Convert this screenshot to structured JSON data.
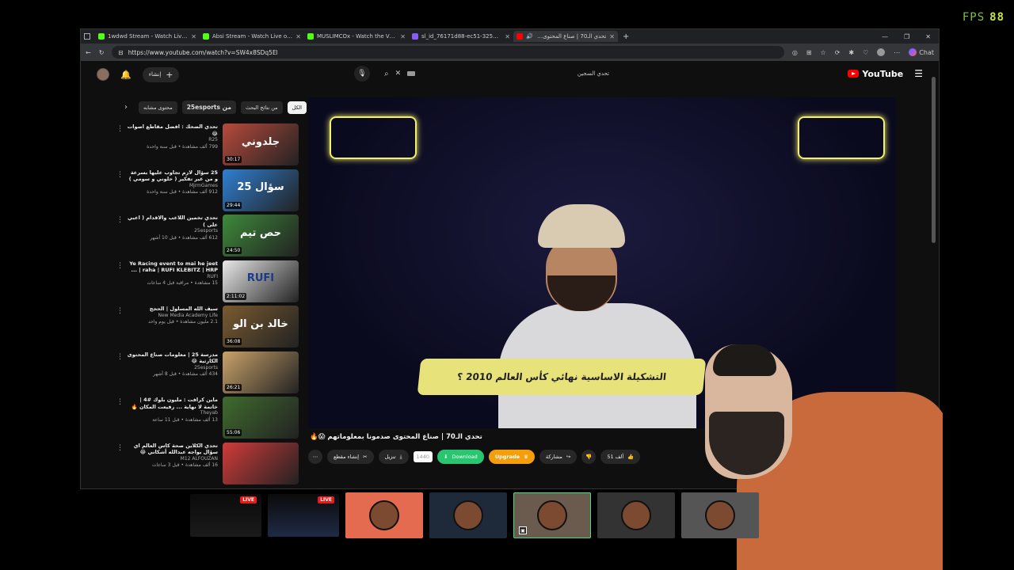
{
  "fps": {
    "label": "FPS",
    "value": "88"
  },
  "tabs": [
    {
      "title": "1wdwd Stream - Watch Live on Ki",
      "fav": "kick"
    },
    {
      "title": "Absi Stream - Watch Live on Kick",
      "fav": "kick"
    },
    {
      "title": "MUSLIMCOx - Watch the VOD or",
      "fav": "kick"
    },
    {
      "title": "sl_id_76171d88-ec51-3250-97ed",
      "fav": "doc"
    },
    {
      "title": "تحدي الـ70 | صناع المحتوى ص...",
      "fav": "yt"
    }
  ],
  "addressbar": {
    "url": "https://www.youtube.com/watch?v=SW4x8SDq5El",
    "chat_label": "Chat"
  },
  "yt_header": {
    "create_label": "إنشاء",
    "search_query": "تحدي السجين",
    "logo_text": "YouTube"
  },
  "chips": [
    "الكل",
    "من نتائج البحث",
    "من 25esports",
    "محتوى مشابه"
  ],
  "recommendations": [
    {
      "title": "تحدي الضحك : افضل مقاطع اصوات 😂",
      "channel": "R25",
      "stats": "799 ألف مشاهدة • قبل سنة واحدة",
      "duration": "30:17",
      "thumb_color": "#b74a3c",
      "caption": "جلدوني"
    },
    {
      "title": "25 سؤال لازم تجاوب عليها بسرعة و من غير تفكير ( حلوني و سومي )",
      "channel": "MjrmGames",
      "stats": "912 ألف مشاهدة • قبل سنة واحدة",
      "duration": "29:44",
      "thumb_color": "#2f7fd1",
      "caption": "25 سؤال"
    },
    {
      "title": "تحدي تخمين اللاعب والاقدام ( اعبي على )",
      "channel": "25esports",
      "stats": "612 ألف مشاهدة • قبل 10 أشهر",
      "duration": "24:50",
      "thumb_color": "#3d8a3a",
      "caption": "حص تيم"
    },
    {
      "title": "Ye Racing event to mai he jeet raha | RUFI KLEBITZ | HRP | ...",
      "channel": "RUFI",
      "stats": "15 مشاهدة • مراقبة قبل 4 ساعات",
      "duration": "2:11:02",
      "thumb_color": "#e8e8e8",
      "caption": "RUFI"
    },
    {
      "title": "سيف الله المسلول | الحجج",
      "channel": "New Media Academy Life",
      "stats": "2.1 مليون مشاهدة • قبل يوم واحد",
      "duration": "36:08",
      "thumb_color": "#7a5a30",
      "caption": "خالد بن الو"
    },
    {
      "title": "مدرسة 25 | معلومات صناع المحتوى الكارثية 😂",
      "channel": "25esports",
      "stats": "434 ألف مشاهدة • قبل 8 أشهر",
      "duration": "26:21",
      "thumb_color": "#c9a26a",
      "caption": ""
    },
    {
      "title": "ماين كرافت : مليون بلوك #4 | خاتمة لا نهاية ... رفيعت المكان 🔥",
      "channel": "Theyab",
      "stats": "13 ألف مشاهدة • قبل 11 ساعة",
      "duration": "55:06",
      "thumb_color": "#3f6b2e",
      "caption": ""
    },
    {
      "title": "تحدي الكلاين صحة كاس العالم اي سؤال يواجه عبدالله أشكاني 😂",
      "channel": "M12 ALFOUZAN",
      "stats": "16 ألف مشاهدة • قبل 3 ساعات",
      "duration": "",
      "thumb_color": "#d23a3a",
      "caption": ""
    }
  ],
  "player": {
    "banner_text": "التشكيلة الاساسية نهائي كأس العالم 2010 ؟"
  },
  "video": {
    "title": "تحدي الـ70 | صناع المحتوى صدمونا بمعلوماتهم 😱🔥",
    "likes": "51 ألف",
    "share_label": "مشاركة",
    "upgrade_label": "Upgrade",
    "download_label": "Download",
    "count_label": "1440",
    "save_label": "تنزيل",
    "clip_label": "إنشاء مقطع"
  },
  "streams": [
    {
      "live": "LIVE",
      "color": "#1a1a1a"
    },
    {
      "live": "LIVE",
      "color": "#1f2a44"
    },
    {
      "live": "",
      "color": "#e46b4f"
    },
    {
      "live": "",
      "color": "#1e2a3a"
    },
    {
      "live": "",
      "color": "#6b5a4e"
    },
    {
      "live": "",
      "color": "#333"
    },
    {
      "live": "",
      "color": "#555"
    }
  ]
}
